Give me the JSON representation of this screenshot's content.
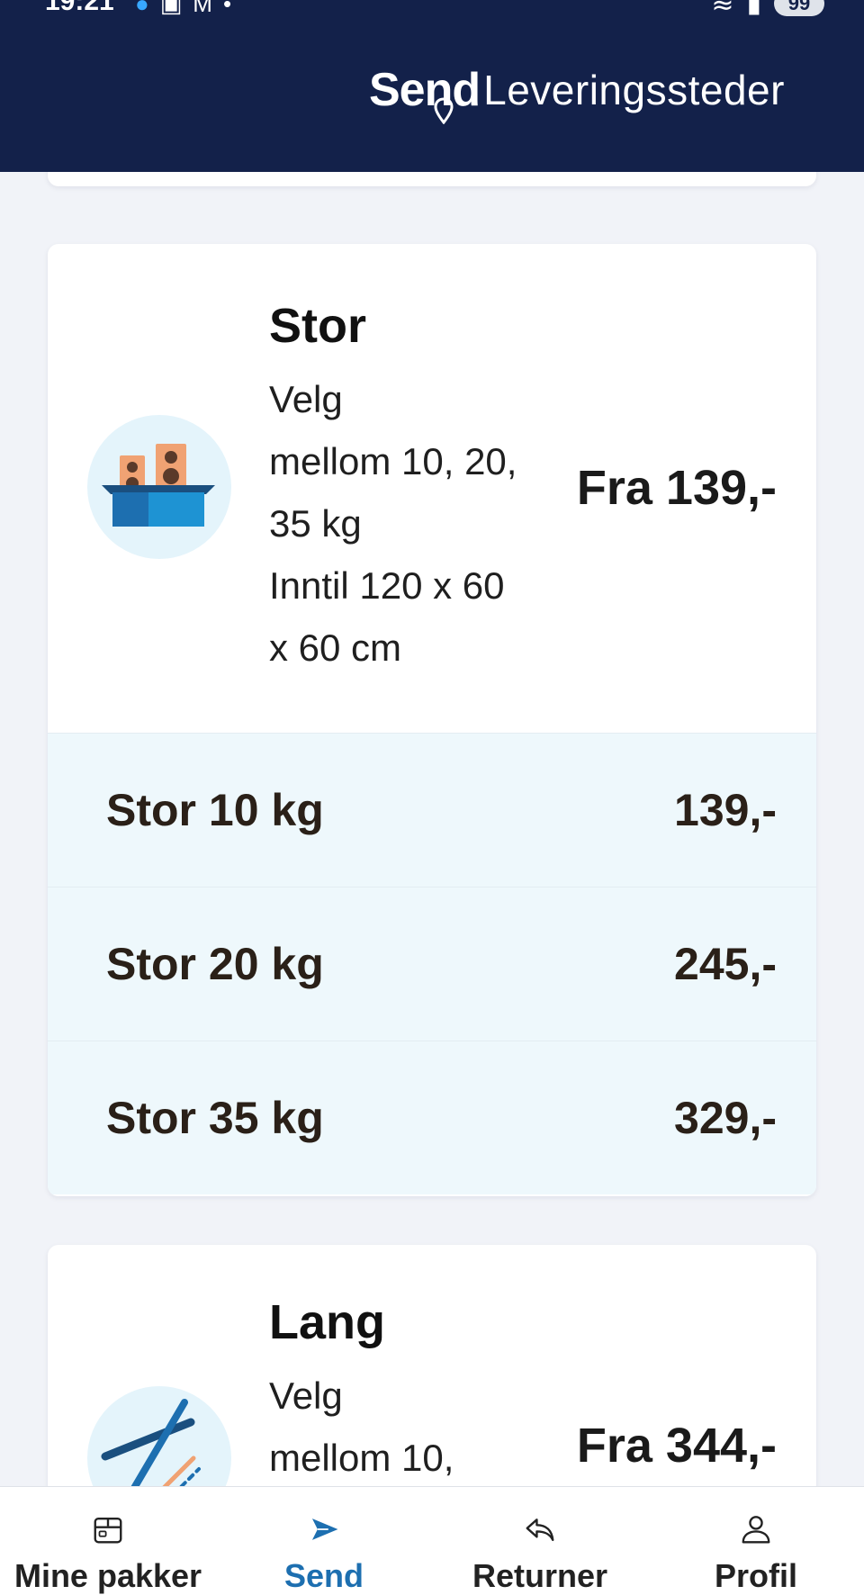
{
  "status_bar": {
    "time": "19:21",
    "battery": "99"
  },
  "header": {
    "logo_text": "Send",
    "title": "Leveringssteder"
  },
  "cards": [
    {
      "title": "Stor",
      "description_lines": [
        "Velg",
        "mellom 10, 20,",
        "35 kg",
        "Inntil 120 x 60",
        "x 60 cm"
      ],
      "price_from": "Fra 139,-",
      "icon": "boxed-speakers-illustration",
      "options": [
        {
          "label": "Stor 10 kg",
          "price": "139,-"
        },
        {
          "label": "Stor 20 kg",
          "price": "245,-"
        },
        {
          "label": "Stor 35 kg",
          "price": "329,-"
        }
      ]
    },
    {
      "title": "Lang",
      "description_lines": [
        "Velg",
        "mellom 10,"
      ],
      "price_from": "Fra 344,-",
      "icon": "skis-illustration"
    }
  ],
  "bottom_nav": [
    {
      "label": "Mine pakker",
      "icon": "package-icon",
      "active": false
    },
    {
      "label": "Send",
      "icon": "send-arrow-icon",
      "active": true
    },
    {
      "label": "Returner",
      "icon": "return-arrow-icon",
      "active": false
    },
    {
      "label": "Profil",
      "icon": "user-icon",
      "active": false
    }
  ],
  "colors": {
    "header_bg": "#13214a",
    "accent": "#1d6fb0",
    "option_bg": "#eef8fc"
  }
}
